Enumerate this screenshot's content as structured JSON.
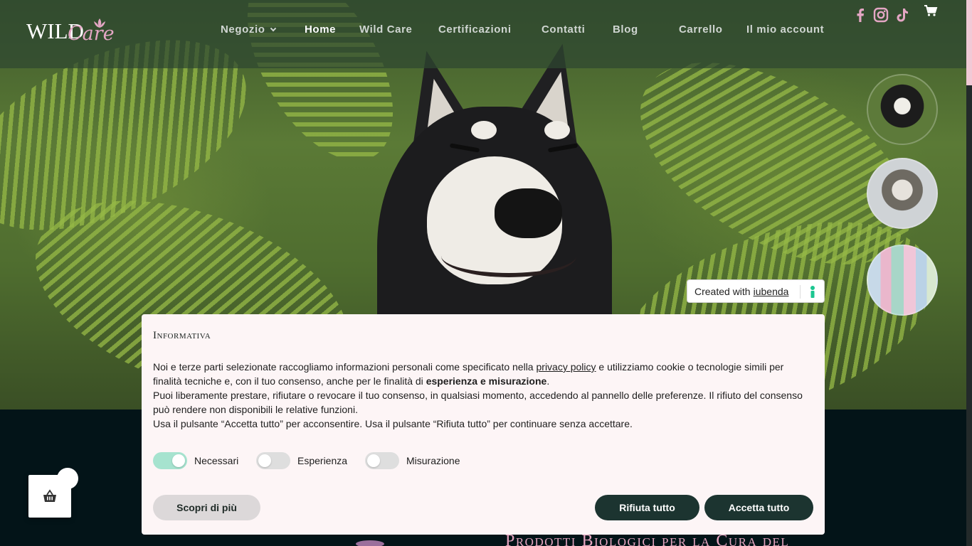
{
  "brand": {
    "logo_wild": "WILD",
    "logo_care": "Care"
  },
  "nav": {
    "items": [
      {
        "label": "Negozio",
        "has_dropdown": true
      },
      {
        "label": "Home",
        "active": true
      },
      {
        "label": "Wild Care"
      },
      {
        "label": "Certificazioni"
      },
      {
        "label": "Contatti"
      },
      {
        "label": "Blog"
      },
      {
        "label": "Carrello"
      },
      {
        "label": "Il mio account"
      }
    ],
    "social": [
      "facebook-icon",
      "instagram-icon",
      "tiktok-icon"
    ],
    "cart_icon": "cart-icon"
  },
  "colors": {
    "accent_pink": "#e4a6c4",
    "dark_green": "#1c3430",
    "toggle_on": "#a6e3cf"
  },
  "iubenda": {
    "prefix": "Created with",
    "link": "iubenda"
  },
  "cookie": {
    "title": "Informativa",
    "p1_a": "Noi e terze parti selezionate raccogliamo informazioni personali come specificato nella ",
    "p1_link": "privacy policy",
    "p1_b": " e utilizziamo cookie o tecnologie simili per finalità tecniche e, con il tuo consenso, anche per le finalità di ",
    "p1_bold": "esperienza e misurazione",
    "p1_c": ".",
    "p2": "Puoi liberamente prestare, rifiutare o revocare il tuo consenso, in qualsiasi momento, accedendo al pannello delle preferenze. Il rifiuto del consenso può rendere non disponibili le relative funzioni.",
    "p3": "Usa il pulsante “Accetta tutto” per acconsentire. Usa il pulsante “Rifiuta tutto” per continuare senza accettare.",
    "toggles": [
      {
        "label": "Necessari",
        "on": true
      },
      {
        "label": "Esperienza",
        "on": false
      },
      {
        "label": "Misurazione",
        "on": false
      }
    ],
    "btn_more": "Scopri di più",
    "btn_reject": "Rifiuta tutto",
    "btn_accept": "Accetta tutto"
  },
  "section": {
    "heading": "Prodotti Biologici per la Cura del"
  },
  "floating_cart": {
    "icon": "basket-icon"
  }
}
